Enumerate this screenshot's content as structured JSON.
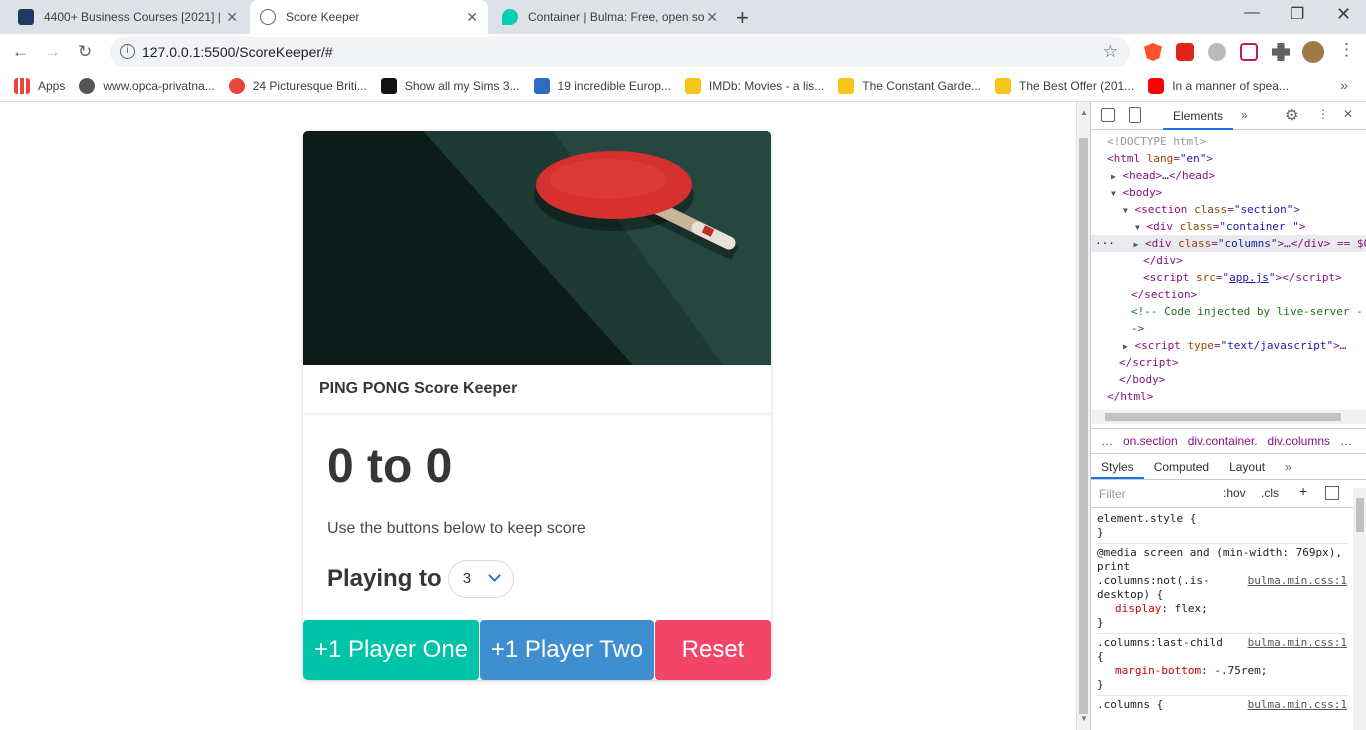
{
  "tabs": [
    {
      "title": "4400+ Business Courses [2021] |",
      "icon": "course-favicon"
    },
    {
      "title": "Score Keeper",
      "icon": "globe-icon"
    },
    {
      "title": "Container | Bulma: Free, open so",
      "icon": "bulma-favicon"
    }
  ],
  "toolbar": {
    "url": "127.0.0.1:5500/ScoreKeeper/#"
  },
  "bookmarks": [
    {
      "label": "Apps",
      "color": "#e8453c"
    },
    {
      "label": "www.opca-privatna...",
      "color": "#555555"
    },
    {
      "label": "24 Picturesque Briti...",
      "color": "#e8453c"
    },
    {
      "label": "Show all my Sims 3...",
      "color": "#111111"
    },
    {
      "label": "19 incredible Europ...",
      "color": "#2d6cc0"
    },
    {
      "label": "IMDb: Movies - a lis...",
      "color": "#f5c518"
    },
    {
      "label": "The Constant Garde...",
      "color": "#f5c518"
    },
    {
      "label": "The Best Offer (201...",
      "color": "#f5c518"
    },
    {
      "label": "In a manner of spea...",
      "color": "#ff0000"
    }
  ],
  "card": {
    "title": "PING PONG Score Keeper",
    "score": "0 to 0",
    "hint": "Use the buttons below to keep score",
    "playing_label": "Playing to",
    "playing_value": "3",
    "buttons": {
      "p1": "+1 Player One",
      "p2": "+1 Player Two",
      "reset": "Reset"
    }
  },
  "devtools": {
    "tab": "Elements",
    "dom": {
      "doctype": "<!DOCTYPE html>",
      "html_lang": "en",
      "head": "…",
      "section_class": "section",
      "container_class": "container ",
      "columns_class": "columns",
      "columns_tail": "…</div> == $0",
      "script_src": "app.js",
      "comment": "<!-- Code injected by live-server -",
      "comment2": "->",
      "script_type": "text/javascript",
      "ellipsis": "…"
    },
    "breadcrumbs": [
      "…",
      "on.section",
      "div.container.",
      "div.columns",
      "…"
    ],
    "panel_tabs": [
      "Styles",
      "Computed",
      "Layout"
    ],
    "filter_placeholder": "Filter",
    "hov": ":hov",
    "cls": ".cls",
    "rules": {
      "element_style": "element.style {",
      "media1": "@media screen and (min-width: 769px),",
      "media2": "print",
      "sel1a": ".columns:not(.is-",
      "sel1b": "desktop) {",
      "src": "bulma.min.css:1",
      "prop1": "display",
      "val1": "flex;",
      "sel2": ".columns:last-child",
      "prop2": "margin-bottom",
      "val2": "-.75rem;",
      "sel3": ".columns {"
    }
  }
}
